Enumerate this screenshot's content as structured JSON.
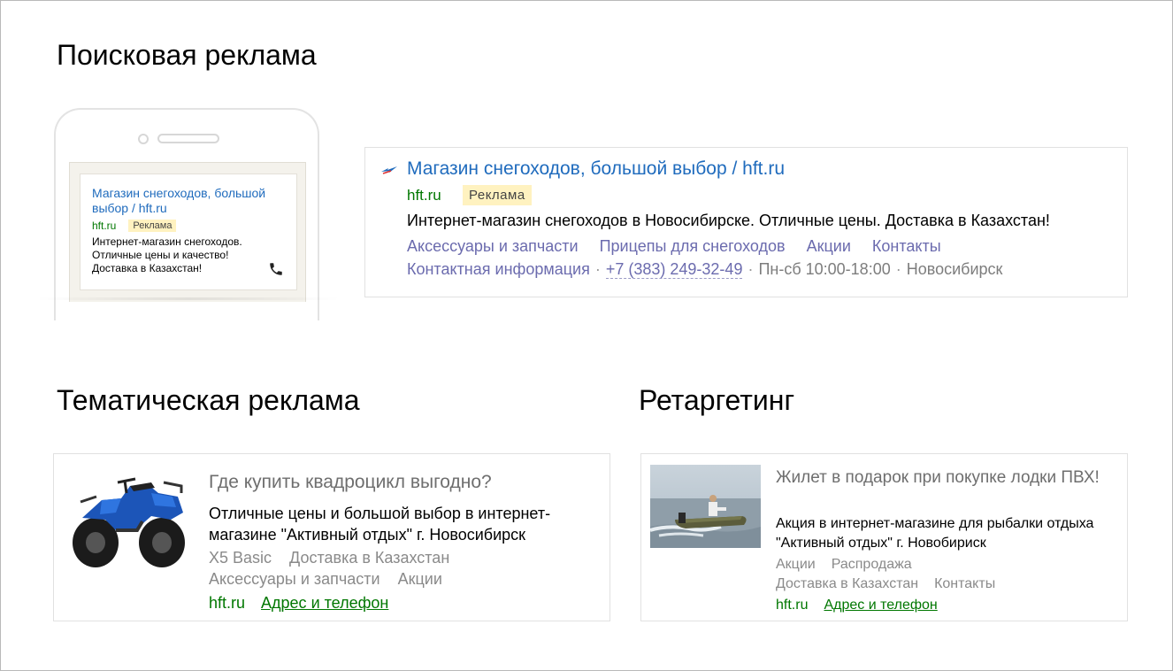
{
  "sections": {
    "search": "Поисковая реклама",
    "thematic": "Тематическая реклама",
    "retargeting": "Ретаргетинг"
  },
  "mobile_ad": {
    "title": "Магазин снегоходов, большой выбор / hft.ru",
    "domain": "hft.ru",
    "badge": "Реклама",
    "text": "Интернет-магазин снегоходов. Отличные цены и качество! Доставка в Казахстан!",
    "icon": "phone-call-icon"
  },
  "search_ad": {
    "title": "Магазин снегоходов, большой выбор / hft.ru",
    "domain": "hft.ru",
    "badge": "Реклама",
    "text": "Интернет-магазин снегоходов в Новосибирске. Отличные цены. Доставка в Казахстан!",
    "sitelinks": [
      "Аксессуары и запчасти",
      "Прицепы для снегоходов",
      "Акции",
      "Контакты"
    ],
    "contact_info": "Контактная информация",
    "phone": "+7 (383) 249-32-49",
    "hours": "Пн-сб 10:00-18:00",
    "city": "Новосибирск",
    "separator": "·"
  },
  "thematic_ad": {
    "title": "Где купить квадроцикл выгодно?",
    "text": "Отличные цены и большой выбор в интернет-магазине \"Активный отдых\" г. Новосибирск",
    "links_row1": [
      "X5 Basic",
      "Доставка в Казахстан"
    ],
    "links_row2": [
      "Аксессуары и запчасти",
      "Акции"
    ],
    "domain": "hft.ru",
    "address_link": "Адрес и телефон"
  },
  "retargeting_ad": {
    "title": "Жилет в подарок при покупке лодки ПВХ!",
    "text": "Акция в интернет-магазине для рыбалки отдыха \"Активный отдых\" г. Новобириск",
    "links_row1": [
      "Акции",
      "Распродажа"
    ],
    "links_row2": [
      "Доставка в Казахстан",
      "Контакты"
    ],
    "domain": "hft.ru",
    "address_link": "Адрес и телефон"
  },
  "colors": {
    "link_blue": "#1f6bbd",
    "domain_green": "#007700",
    "badge_yellow": "#fff2c0",
    "sitelink_purple": "#6b6bae"
  }
}
